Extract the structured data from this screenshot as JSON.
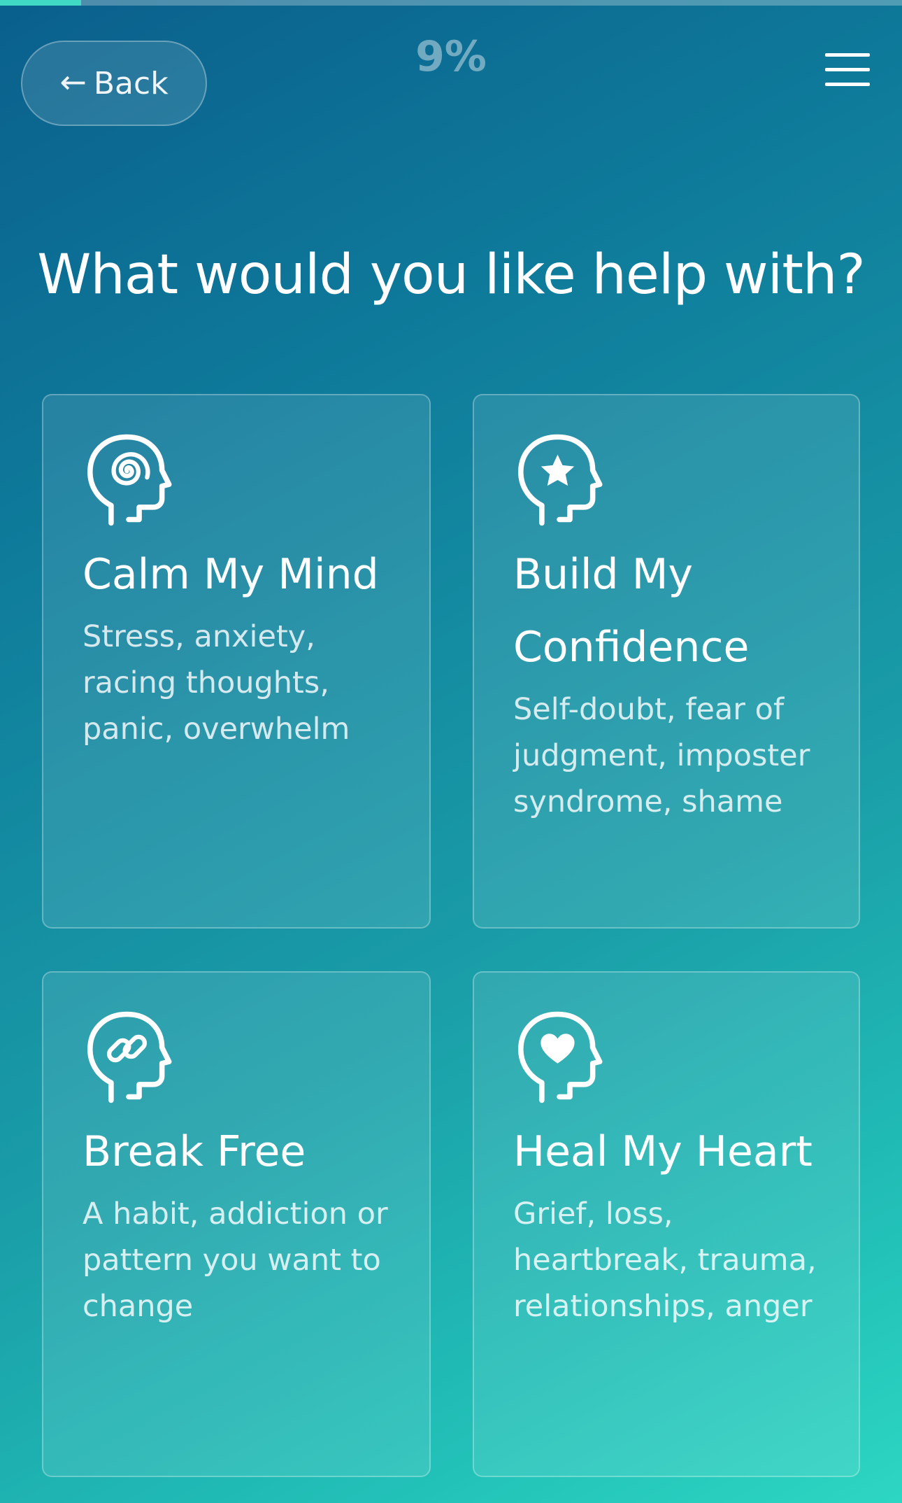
{
  "progress": {
    "fraction": 0.09,
    "percent_label": "9%"
  },
  "header": {
    "back_arrow": "←",
    "back_label": "Back",
    "menu_icon": "hamburger-menu-icon"
  },
  "main": {
    "title": "What would you like help with?",
    "cards": [
      {
        "icon": "spiral-head-icon",
        "title": "Calm My Mind",
        "description": "Stress, anxiety, racing thoughts, panic, overwhelm"
      },
      {
        "icon": "star-head-icon",
        "title": "Build My Confidence",
        "description": "Self-doubt, fear of judgment, imposter syndrome, shame"
      },
      {
        "icon": "link-head-icon",
        "title": "Break Free",
        "description": "A habit, addiction or pattern you want to change"
      },
      {
        "icon": "heart-head-icon",
        "title": "Heal My Heart",
        "description": "Grief, loss, heartbreak, trauma, relationships, anger"
      }
    ]
  },
  "colors": {
    "gradient_start": "#0a5f8c",
    "gradient_end": "#2dd6c2",
    "progress_accent": "#3fd9c4",
    "text": "#ffffff"
  }
}
